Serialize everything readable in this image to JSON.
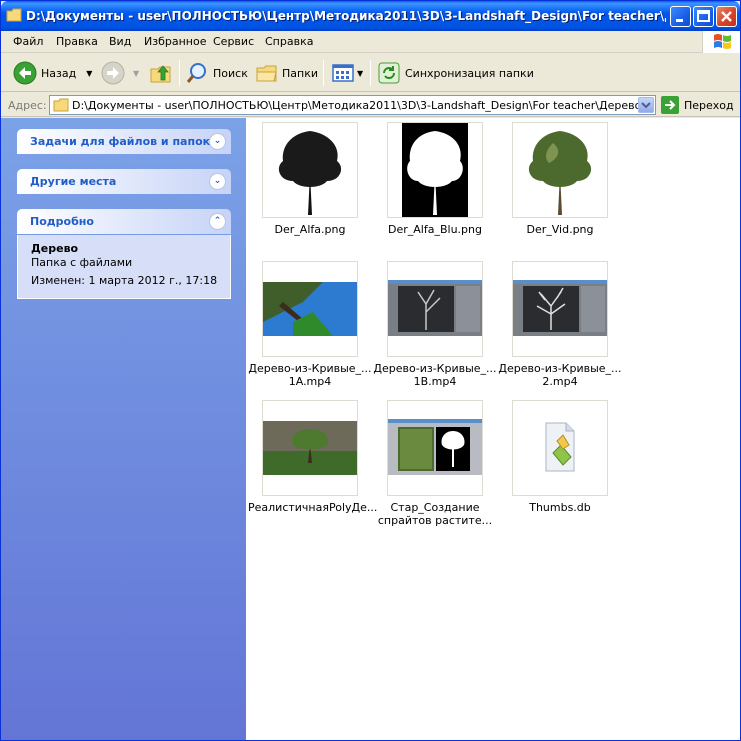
{
  "window": {
    "title": "D:\\Документы - user\\ПОЛНОСТЬЮ\\Центр\\Методика2011\\3D\\3-Landshaft_Design\\For teacher\\Дерево"
  },
  "menu": {
    "items": [
      {
        "label": "Файл"
      },
      {
        "label": "Правка"
      },
      {
        "label": "Вид"
      },
      {
        "label": "Избранное"
      },
      {
        "label": "Сервис"
      },
      {
        "label": "Справка"
      }
    ]
  },
  "toolbar": {
    "back_label": "Назад",
    "search_label": "Поиск",
    "folders_label": "Папки",
    "sync_label": "Синхронизация папки"
  },
  "address": {
    "label": "Адрес:",
    "value": "D:\\Документы - user\\ПОЛНОСТЬЮ\\Центр\\Методика2011\\3D\\3-Landshaft_Design\\For teacher\\Дерево",
    "go_label": "Переход"
  },
  "left_panel": {
    "tasks_title": "Задачи для файлов и папок",
    "places_title": "Другие места",
    "details_title": "Подробно",
    "details": {
      "name": "Дерево",
      "type": "Папка с файлами",
      "modified": "Изменен: 1 марта 2012 г., 17:18"
    }
  },
  "files": [
    {
      "label": "Der_Alfa.png"
    },
    {
      "label": "Der_Alfa_Blu.png"
    },
    {
      "label": "Der_Vid.png"
    },
    {
      "label": "Дерево-из-Кривые_... 1A.mp4"
    },
    {
      "label": "Дерево-из-Кривые_... 1B.mp4"
    },
    {
      "label": "Дерево-из-Кривые_... 2.mp4"
    },
    {
      "label": "РеалистичнаяPolyДе..."
    },
    {
      "label": "Стар_Создание спрайтов растите..."
    },
    {
      "label": "Thumbs.db"
    }
  ],
  "colors": {
    "title_blue": "#0054e3",
    "panel_link": "#215dc6",
    "panel_bg": "#7ba2e7"
  }
}
